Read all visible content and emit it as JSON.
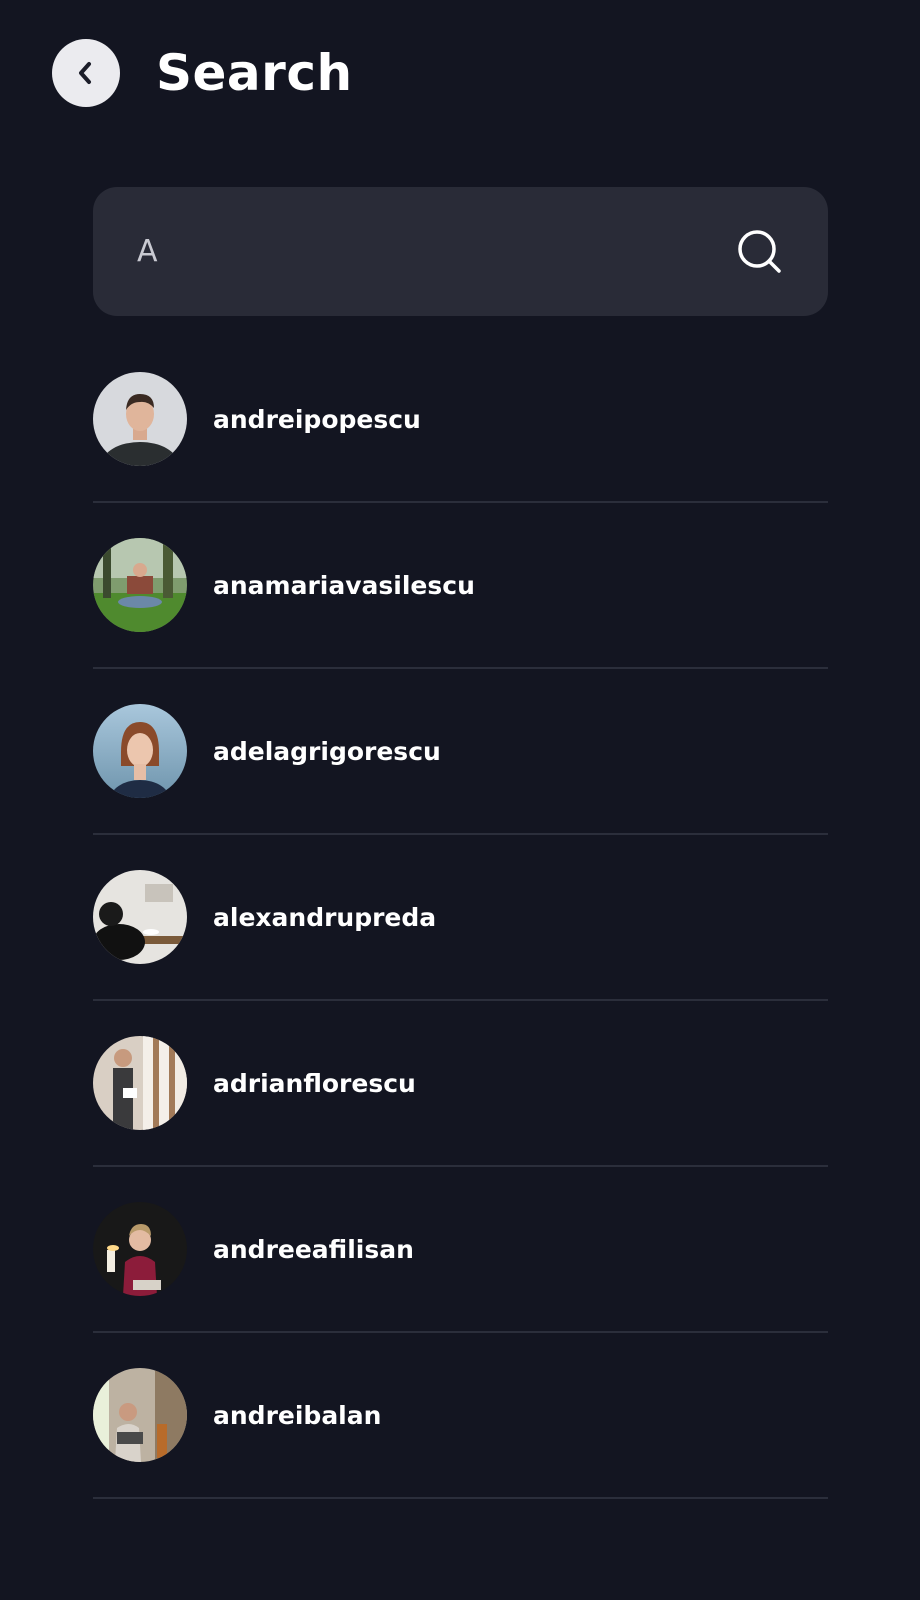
{
  "header": {
    "title": "Search",
    "back_icon": "chevron-left-icon"
  },
  "search": {
    "value": "A",
    "placeholder": "",
    "icon": "search-icon"
  },
  "results": [
    {
      "username": "andreipopescu"
    },
    {
      "username": "anamariavasilescu"
    },
    {
      "username": "adelagrigorescu"
    },
    {
      "username": "alexandrupreda"
    },
    {
      "username": "adrianflorescu"
    },
    {
      "username": "andreeafilisan"
    },
    {
      "username": "andreibalan"
    }
  ],
  "colors": {
    "background": "#131521",
    "search_bg": "#292b37",
    "divider": "#2b2e3b",
    "back_button_bg": "#ebebef"
  }
}
